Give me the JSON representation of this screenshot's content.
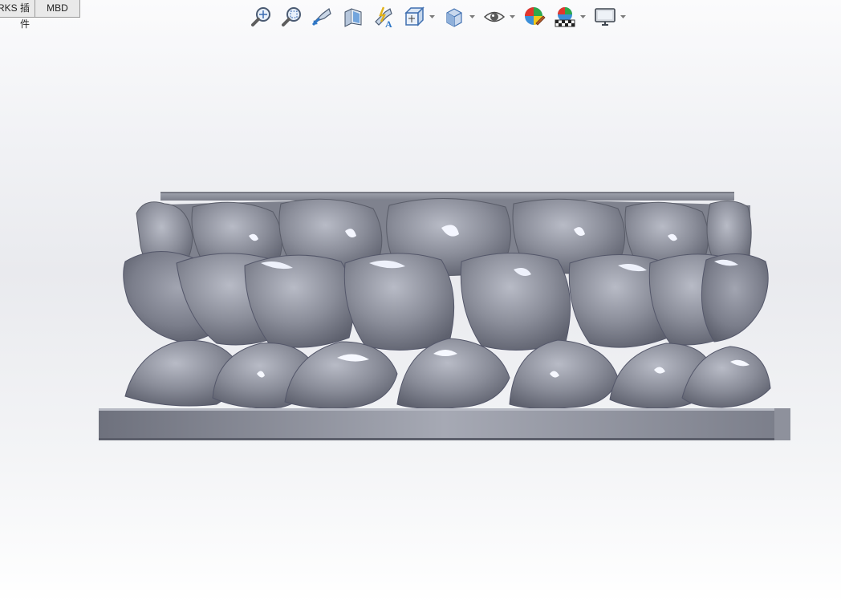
{
  "tabs": [
    {
      "label": "RKS 插件"
    },
    {
      "label": "MBD"
    }
  ],
  "heads_up_toolbar": {
    "tools": [
      {
        "name": "zoom-to-fit-icon"
      },
      {
        "name": "zoom-to-area-icon"
      },
      {
        "name": "previous-view-icon"
      },
      {
        "name": "section-view-icon"
      },
      {
        "name": "dynamic-annotation-views-icon"
      },
      {
        "name": "view-orientation-icon",
        "has_dropdown": true
      },
      {
        "name": "display-style-icon",
        "has_dropdown": true
      },
      {
        "name": "hide-show-items-icon",
        "has_dropdown": true
      },
      {
        "name": "edit-appearance-icon"
      },
      {
        "name": "apply-scene-icon",
        "has_dropdown": true
      },
      {
        "name": "view-settings-icon",
        "has_dropdown": true
      }
    ]
  },
  "colors": {
    "model": "#8a8d99",
    "model_highlight": "#f4f6ff",
    "model_shadow": "#4f5260",
    "accent_blue": "#2f77c6"
  }
}
